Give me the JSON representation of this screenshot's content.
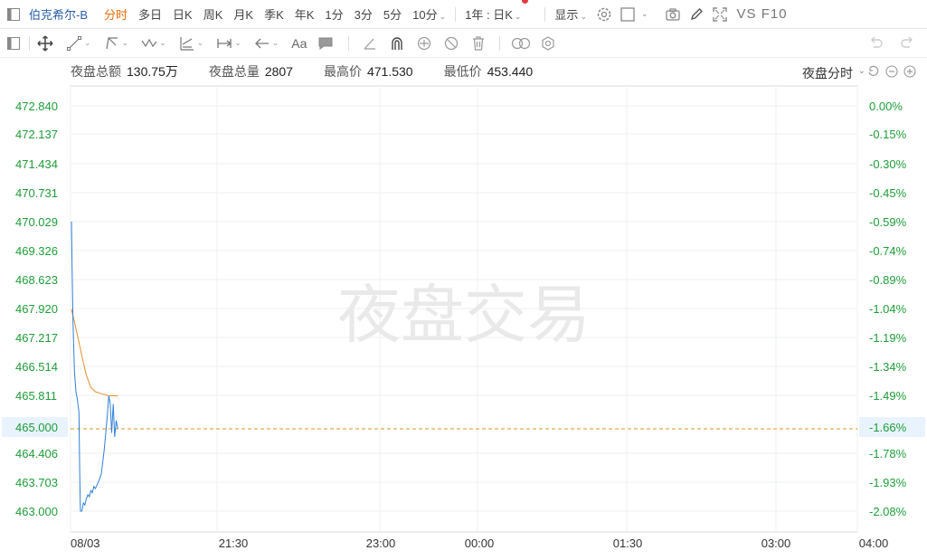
{
  "toolbar": {
    "stock_name": "伯克希尔-B",
    "tabs": [
      "分时",
      "多日",
      "日K",
      "周K",
      "月K",
      "季K",
      "年K",
      "1分",
      "3分",
      "5分",
      "10分"
    ],
    "active_tab": "分时",
    "range_selector": "1年 : 日K",
    "display_label": "显示",
    "vs_label": "VS",
    "f10_label": "F10"
  },
  "drawing_tools": {
    "text_tool_label": "Aa"
  },
  "info_bar": {
    "turnover_label": "夜盘总额",
    "turnover_value": "130.75万",
    "volume_label": "夜盘总量",
    "volume_value": "2807",
    "high_label": "最高价",
    "high_value": "471.530",
    "low_label": "最低价",
    "low_value": "453.440",
    "mode_label": "夜盘分时"
  },
  "chart_data": {
    "type": "line",
    "watermark": "夜盘交易",
    "y_ticks": [
      "472.840",
      "472.137",
      "471.434",
      "470.731",
      "470.029",
      "469.326",
      "468.623",
      "467.920",
      "467.217",
      "466.514",
      "465.811",
      "465.000",
      "464.406",
      "463.703",
      "463.000"
    ],
    "y_values": [
      472.84,
      472.137,
      471.434,
      470.731,
      470.029,
      469.326,
      468.623,
      467.92,
      467.217,
      466.514,
      465.811,
      465.0,
      464.406,
      463.703,
      463.0
    ],
    "pct_ticks": [
      "0.00%",
      "-0.15%",
      "-0.30%",
      "-0.45%",
      "-0.59%",
      "-0.74%",
      "-0.89%",
      "-1.04%",
      "-1.19%",
      "-1.34%",
      "-1.49%",
      "-1.66%",
      "-1.78%",
      "-1.93%",
      "-2.08%"
    ],
    "x_ticks": [
      "08/03",
      "21:30",
      "23:00",
      "00:00",
      "01:30",
      "03:00",
      "04:00"
    ],
    "current_price": "465.000",
    "current_pct": "-1.66%",
    "price_series": {
      "color": "#2f7fd8",
      "points": [
        [
          0,
          470.03
        ],
        [
          0.5,
          468.8
        ],
        [
          1,
          467.6
        ],
        [
          2,
          466.4
        ],
        [
          3,
          465.9
        ],
        [
          4,
          465.7
        ],
        [
          5,
          465.4
        ],
        [
          5.5,
          464.0
        ],
        [
          6,
          463.0
        ],
        [
          7,
          463.0
        ],
        [
          8,
          463.2
        ],
        [
          9,
          463.15
        ],
        [
          10,
          463.3
        ],
        [
          11,
          463.4
        ],
        [
          12,
          463.35
        ],
        [
          13,
          463.5
        ],
        [
          14,
          463.45
        ],
        [
          15,
          463.6
        ],
        [
          16,
          463.55
        ],
        [
          18,
          463.7
        ],
        [
          20,
          463.9
        ],
        [
          22,
          464.5
        ],
        [
          24,
          465.3
        ],
        [
          25,
          465.8
        ],
        [
          26,
          465.6
        ],
        [
          27,
          464.9
        ],
        [
          28,
          465.6
        ],
        [
          29,
          464.8
        ],
        [
          30,
          465.2
        ],
        [
          31,
          465.0
        ]
      ]
    },
    "avg_series": {
      "color": "#e0902a",
      "points": [
        [
          0,
          467.9
        ],
        [
          2,
          467.6
        ],
        [
          5,
          467.1
        ],
        [
          8,
          466.6
        ],
        [
          10,
          466.3
        ],
        [
          13,
          466.0
        ],
        [
          16,
          465.9
        ],
        [
          20,
          465.85
        ],
        [
          25,
          465.8
        ],
        [
          31,
          465.8
        ]
      ]
    }
  }
}
